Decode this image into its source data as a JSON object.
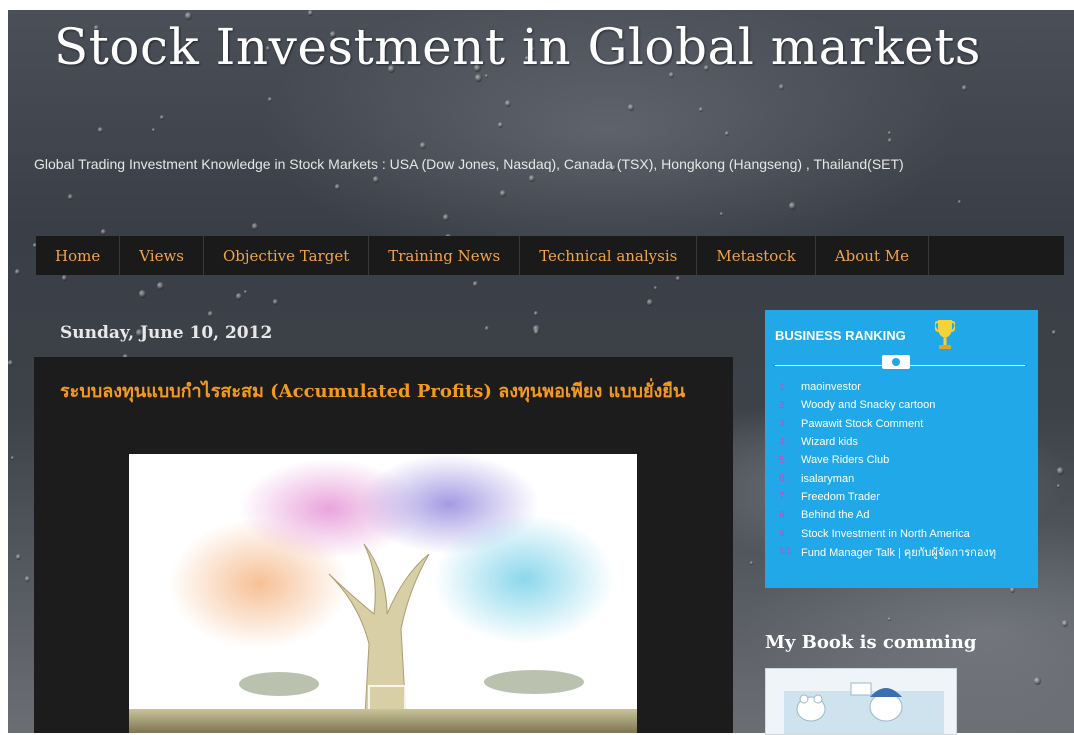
{
  "blog": {
    "title": "Stock Investment in Global markets",
    "description": "Global Trading Investment Knowledge in Stock Markets : USA (Dow Jones, Nasdaq), Canada (TSX), Hongkong (Hangseng) , Thailand(SET)"
  },
  "nav": {
    "items": [
      {
        "label": "Home"
      },
      {
        "label": "Views"
      },
      {
        "label": "Objective Target"
      },
      {
        "label": "Training News"
      },
      {
        "label": "Technical analysis"
      },
      {
        "label": "Metastock"
      },
      {
        "label": "About Me"
      }
    ]
  },
  "post": {
    "date": "Sunday, June 10, 2012",
    "title": "ระบบลงทุนแบบกำไรสะสม (Accumulated Profits) ลงทุนพอเพียง แบบยั่งยืน",
    "image_icon": "money-tree-illustration"
  },
  "sidebar": {
    "ranking": {
      "title": "BUSINESS RANKING",
      "items": [
        {
          "num": "1.",
          "label": "maoinvestor"
        },
        {
          "num": "2.",
          "label": "Woody and Snacky cartoon"
        },
        {
          "num": "3.",
          "label": "Pawawit Stock Comment"
        },
        {
          "num": "4.",
          "label": "Wizard kids"
        },
        {
          "num": "5.",
          "label": "Wave Riders Club"
        },
        {
          "num": "6.",
          "label": "isalaryman"
        },
        {
          "num": "7.",
          "label": "Freedom Trader"
        },
        {
          "num": "8.",
          "label": "Behind the Ad"
        },
        {
          "num": "9.",
          "label": "Stock Investment in North America"
        },
        {
          "num": "10.",
          "label": "Fund Manager Talk | คุยกับผู้จัดการกองทุ"
        }
      ]
    },
    "book": {
      "title": "My Book is comming",
      "image_icon": "book-cover-illustration"
    }
  },
  "colors": {
    "accent_orange": "#f39a1e",
    "nav_text": "#f0a44a",
    "ranking_bg": "#21a8e8"
  }
}
